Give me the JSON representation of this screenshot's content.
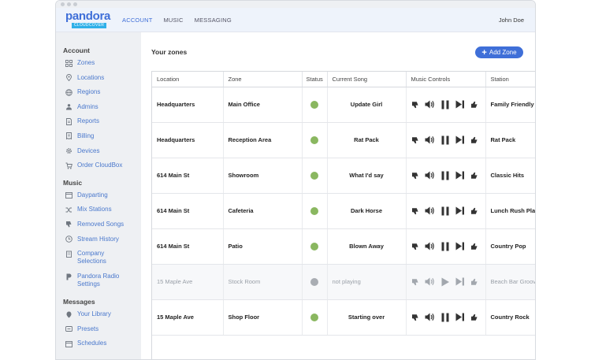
{
  "app": {
    "logo_word": "pandora",
    "logo_badge": "CLOUDCOVER"
  },
  "nav": {
    "items": [
      "ACCOUNT",
      "MUSIC",
      "MESSAGING"
    ],
    "user": "John Doe"
  },
  "sidebar": {
    "account_heading": "Account",
    "account_items": [
      "Zones",
      "Locations",
      "Regions",
      "Admins",
      "Reports",
      "Billing",
      "Devices",
      "Order CloudBox"
    ],
    "music_heading": "Music",
    "music_items": [
      "Dayparting",
      "Mix Stations",
      "Removed Songs",
      "Stream History",
      "Company Selections",
      "Pandora Radio Settings"
    ],
    "messages_heading": "Messages",
    "messages_items": [
      "Your Library",
      "Presets",
      "Schedules"
    ]
  },
  "main": {
    "title": "Your zones",
    "add_zone": "Add Zone",
    "columns": [
      "Location",
      "Zone",
      "Status",
      "Current Song",
      "Music Controls",
      "Station"
    ],
    "rows": [
      {
        "location": "Headquarters",
        "zone": "Main Office",
        "song": "Update Girl",
        "station": "Family Friendly"
      },
      {
        "location": "Headquarters",
        "zone": "Reception Area",
        "song": "Rat Pack",
        "station": "Rat Pack"
      },
      {
        "location": "614 Main St",
        "zone": "Showroom",
        "song": "What I'd say",
        "station": "Classic Hits"
      },
      {
        "location": "614 Main St",
        "zone": "Cafeteria",
        "song": "Dark Horse",
        "station": "Lunch Rush Playlist"
      },
      {
        "location": "614 Main St",
        "zone": "Patio",
        "song": "Blown Away",
        "station": "Country Pop"
      },
      {
        "location": "15 Maple Ave",
        "zone": "Stock Room",
        "song": "not playing",
        "station": "Beach Bar Grooves"
      },
      {
        "location": "15 Maple Ave",
        "zone": "Shop Floor",
        "song": "Starting over",
        "station": "Country Rock"
      }
    ]
  },
  "colors": {
    "accent": "#3f6fd8",
    "status_playing": "#8ab760",
    "status_stopped": "#a9adb3"
  }
}
